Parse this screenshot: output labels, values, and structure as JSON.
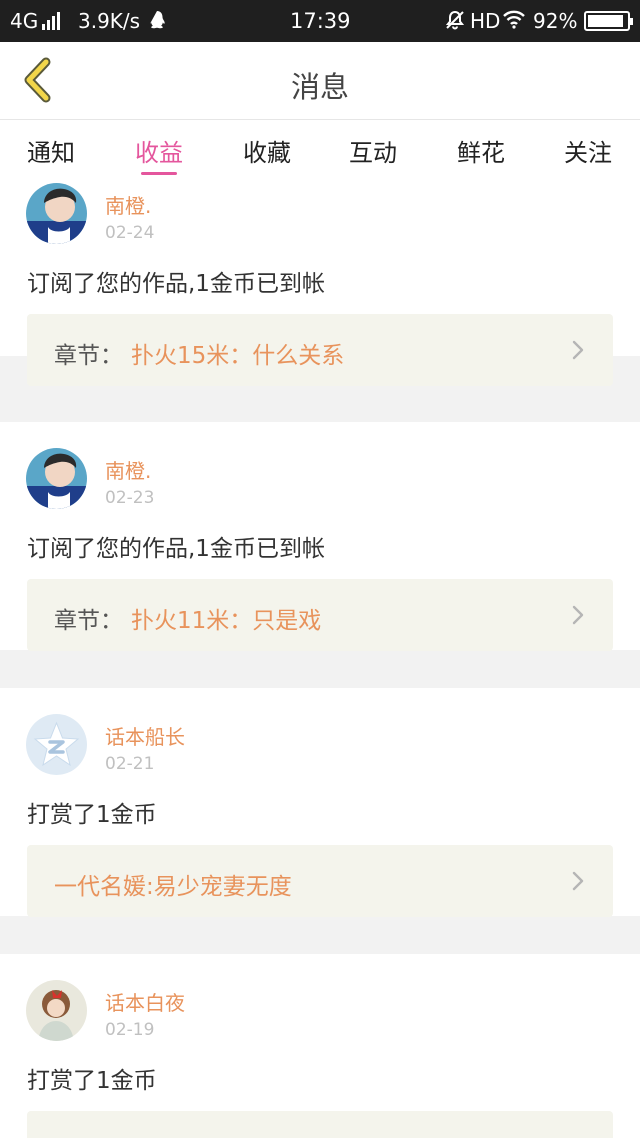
{
  "status_bar": {
    "network": "4G",
    "speed": "3.9K/s",
    "time": "17:39",
    "hd": "HD",
    "battery": "92%",
    "battery_level": 0.92,
    "icons": [
      "signal-icon",
      "qq-icon",
      "mute-icon",
      "wifi-icon",
      "battery-icon"
    ]
  },
  "header": {
    "title": "消息",
    "back_icon": "chevron-left-icon",
    "accent_color": "#f2c94c"
  },
  "tabs": {
    "items": [
      {
        "label": "通知"
      },
      {
        "label": "收益"
      },
      {
        "label": "收藏"
      },
      {
        "label": "互动"
      },
      {
        "label": "鲜花"
      },
      {
        "label": "关注"
      }
    ],
    "active_index": 1,
    "active_color": "#e4569d"
  },
  "messages": [
    {
      "user": "南橙.",
      "date": "02-24",
      "text": "订阅了您的作品,1金币已到帐",
      "ref_label": "章节：",
      "ref_title": "扑火15米：什么关系"
    },
    {
      "user": "南橙.",
      "date": "02-23",
      "text": "订阅了您的作品,1金币已到帐",
      "ref_label": "章节：",
      "ref_title": "扑火11米：只是戏"
    },
    {
      "user": "话本船长",
      "date": "02-21",
      "text": "打赏了1金币",
      "ref_label": "",
      "ref_title": "一代名媛:易少宠妻无度"
    },
    {
      "user": "话本白夜",
      "date": "02-19",
      "text": "打赏了1金币",
      "ref_label": "",
      "ref_title": ""
    }
  ],
  "colors": {
    "name_color": "#e8935c",
    "ref_background": "#f4f4ec",
    "feed_background": "#f2f2f2"
  }
}
